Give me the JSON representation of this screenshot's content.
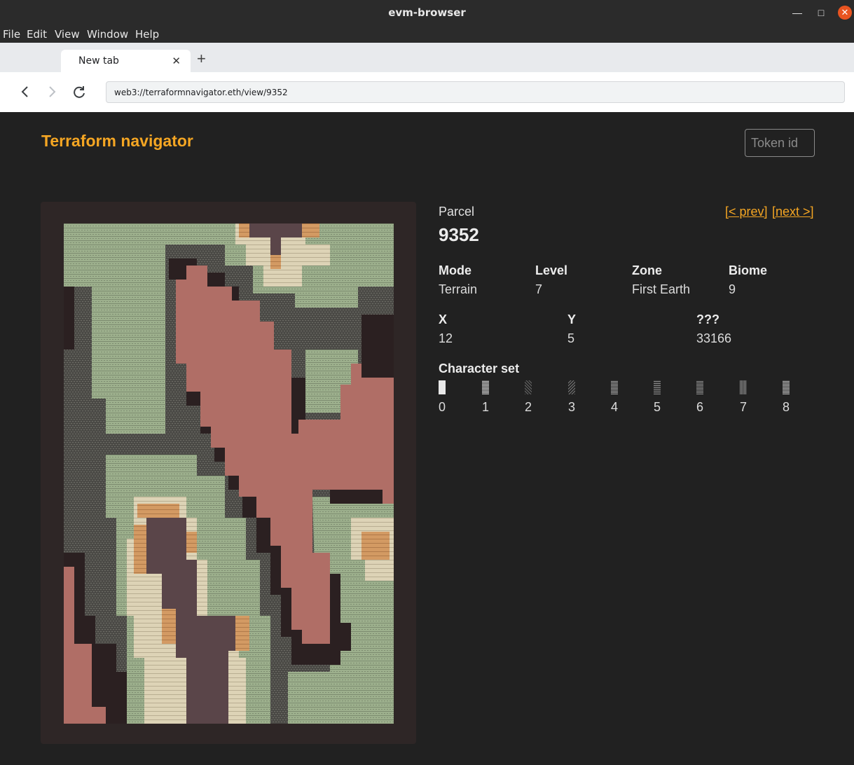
{
  "window": {
    "title": "evm-browser"
  },
  "menu": [
    "File",
    "Edit",
    "View",
    "Window",
    "Help"
  ],
  "tab": {
    "title": "New tab"
  },
  "address": {
    "url": "web3://terraformnavigator.eth/view/9352"
  },
  "app": {
    "title": "Terraform navigator",
    "token_placeholder": "Token id"
  },
  "parcel": {
    "label": "Parcel",
    "id": "9352",
    "prev": "[< prev]",
    "next": "[next >]"
  },
  "fields": {
    "mode": {
      "label": "Mode",
      "value": "Terrain"
    },
    "level": {
      "label": "Level",
      "value": "7"
    },
    "zone": {
      "label": "Zone",
      "value": "First Earth"
    },
    "biome": {
      "label": "Biome",
      "value": "9"
    },
    "x": {
      "label": "X",
      "value": "12"
    },
    "y": {
      "label": "Y",
      "value": "5"
    },
    "unknown": {
      "label": "???",
      "value": "33166"
    }
  },
  "charset": {
    "label": "Character set",
    "indices": [
      "0",
      "1",
      "2",
      "3",
      "4",
      "5",
      "6",
      "7",
      "8"
    ]
  },
  "colors": {
    "accent": "#f5a623",
    "card_bg": "#2e2626",
    "terrain_dark": "#2b2021",
    "terrain_salmon": "#b06e66",
    "terrain_rock": "#5a4549",
    "terrain_green": "#9db08d",
    "terrain_sand": "#ddd3b6",
    "terrain_orange": "#d39a63",
    "terrain_gray": "#55554f"
  }
}
